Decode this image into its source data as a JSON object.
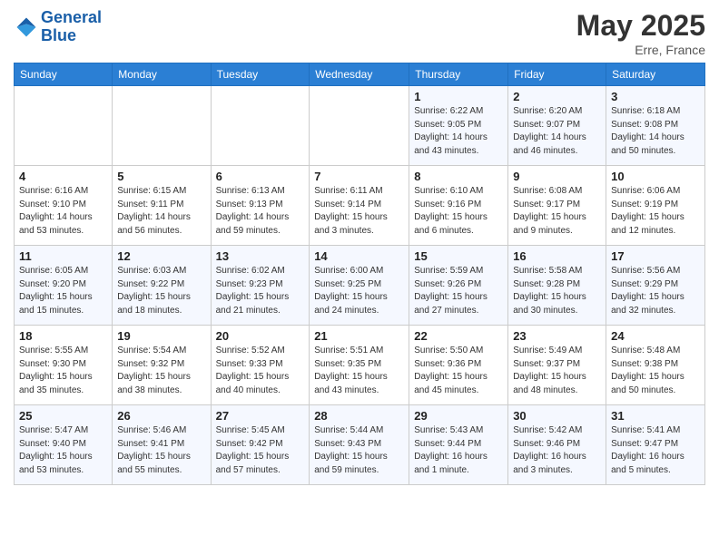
{
  "header": {
    "logo_line1": "General",
    "logo_line2": "Blue",
    "month_title": "May 2025",
    "location": "Erre, France"
  },
  "weekdays": [
    "Sunday",
    "Monday",
    "Tuesday",
    "Wednesday",
    "Thursday",
    "Friday",
    "Saturday"
  ],
  "weeks": [
    [
      {
        "day": "",
        "info": ""
      },
      {
        "day": "",
        "info": ""
      },
      {
        "day": "",
        "info": ""
      },
      {
        "day": "",
        "info": ""
      },
      {
        "day": "1",
        "info": "Sunrise: 6:22 AM\nSunset: 9:05 PM\nDaylight: 14 hours\nand 43 minutes."
      },
      {
        "day": "2",
        "info": "Sunrise: 6:20 AM\nSunset: 9:07 PM\nDaylight: 14 hours\nand 46 minutes."
      },
      {
        "day": "3",
        "info": "Sunrise: 6:18 AM\nSunset: 9:08 PM\nDaylight: 14 hours\nand 50 minutes."
      }
    ],
    [
      {
        "day": "4",
        "info": "Sunrise: 6:16 AM\nSunset: 9:10 PM\nDaylight: 14 hours\nand 53 minutes."
      },
      {
        "day": "5",
        "info": "Sunrise: 6:15 AM\nSunset: 9:11 PM\nDaylight: 14 hours\nand 56 minutes."
      },
      {
        "day": "6",
        "info": "Sunrise: 6:13 AM\nSunset: 9:13 PM\nDaylight: 14 hours\nand 59 minutes."
      },
      {
        "day": "7",
        "info": "Sunrise: 6:11 AM\nSunset: 9:14 PM\nDaylight: 15 hours\nand 3 minutes."
      },
      {
        "day": "8",
        "info": "Sunrise: 6:10 AM\nSunset: 9:16 PM\nDaylight: 15 hours\nand 6 minutes."
      },
      {
        "day": "9",
        "info": "Sunrise: 6:08 AM\nSunset: 9:17 PM\nDaylight: 15 hours\nand 9 minutes."
      },
      {
        "day": "10",
        "info": "Sunrise: 6:06 AM\nSunset: 9:19 PM\nDaylight: 15 hours\nand 12 minutes."
      }
    ],
    [
      {
        "day": "11",
        "info": "Sunrise: 6:05 AM\nSunset: 9:20 PM\nDaylight: 15 hours\nand 15 minutes."
      },
      {
        "day": "12",
        "info": "Sunrise: 6:03 AM\nSunset: 9:22 PM\nDaylight: 15 hours\nand 18 minutes."
      },
      {
        "day": "13",
        "info": "Sunrise: 6:02 AM\nSunset: 9:23 PM\nDaylight: 15 hours\nand 21 minutes."
      },
      {
        "day": "14",
        "info": "Sunrise: 6:00 AM\nSunset: 9:25 PM\nDaylight: 15 hours\nand 24 minutes."
      },
      {
        "day": "15",
        "info": "Sunrise: 5:59 AM\nSunset: 9:26 PM\nDaylight: 15 hours\nand 27 minutes."
      },
      {
        "day": "16",
        "info": "Sunrise: 5:58 AM\nSunset: 9:28 PM\nDaylight: 15 hours\nand 30 minutes."
      },
      {
        "day": "17",
        "info": "Sunrise: 5:56 AM\nSunset: 9:29 PM\nDaylight: 15 hours\nand 32 minutes."
      }
    ],
    [
      {
        "day": "18",
        "info": "Sunrise: 5:55 AM\nSunset: 9:30 PM\nDaylight: 15 hours\nand 35 minutes."
      },
      {
        "day": "19",
        "info": "Sunrise: 5:54 AM\nSunset: 9:32 PM\nDaylight: 15 hours\nand 38 minutes."
      },
      {
        "day": "20",
        "info": "Sunrise: 5:52 AM\nSunset: 9:33 PM\nDaylight: 15 hours\nand 40 minutes."
      },
      {
        "day": "21",
        "info": "Sunrise: 5:51 AM\nSunset: 9:35 PM\nDaylight: 15 hours\nand 43 minutes."
      },
      {
        "day": "22",
        "info": "Sunrise: 5:50 AM\nSunset: 9:36 PM\nDaylight: 15 hours\nand 45 minutes."
      },
      {
        "day": "23",
        "info": "Sunrise: 5:49 AM\nSunset: 9:37 PM\nDaylight: 15 hours\nand 48 minutes."
      },
      {
        "day": "24",
        "info": "Sunrise: 5:48 AM\nSunset: 9:38 PM\nDaylight: 15 hours\nand 50 minutes."
      }
    ],
    [
      {
        "day": "25",
        "info": "Sunrise: 5:47 AM\nSunset: 9:40 PM\nDaylight: 15 hours\nand 53 minutes."
      },
      {
        "day": "26",
        "info": "Sunrise: 5:46 AM\nSunset: 9:41 PM\nDaylight: 15 hours\nand 55 minutes."
      },
      {
        "day": "27",
        "info": "Sunrise: 5:45 AM\nSunset: 9:42 PM\nDaylight: 15 hours\nand 57 minutes."
      },
      {
        "day": "28",
        "info": "Sunrise: 5:44 AM\nSunset: 9:43 PM\nDaylight: 15 hours\nand 59 minutes."
      },
      {
        "day": "29",
        "info": "Sunrise: 5:43 AM\nSunset: 9:44 PM\nDaylight: 16 hours\nand 1 minute."
      },
      {
        "day": "30",
        "info": "Sunrise: 5:42 AM\nSunset: 9:46 PM\nDaylight: 16 hours\nand 3 minutes."
      },
      {
        "day": "31",
        "info": "Sunrise: 5:41 AM\nSunset: 9:47 PM\nDaylight: 16 hours\nand 5 minutes."
      }
    ]
  ]
}
